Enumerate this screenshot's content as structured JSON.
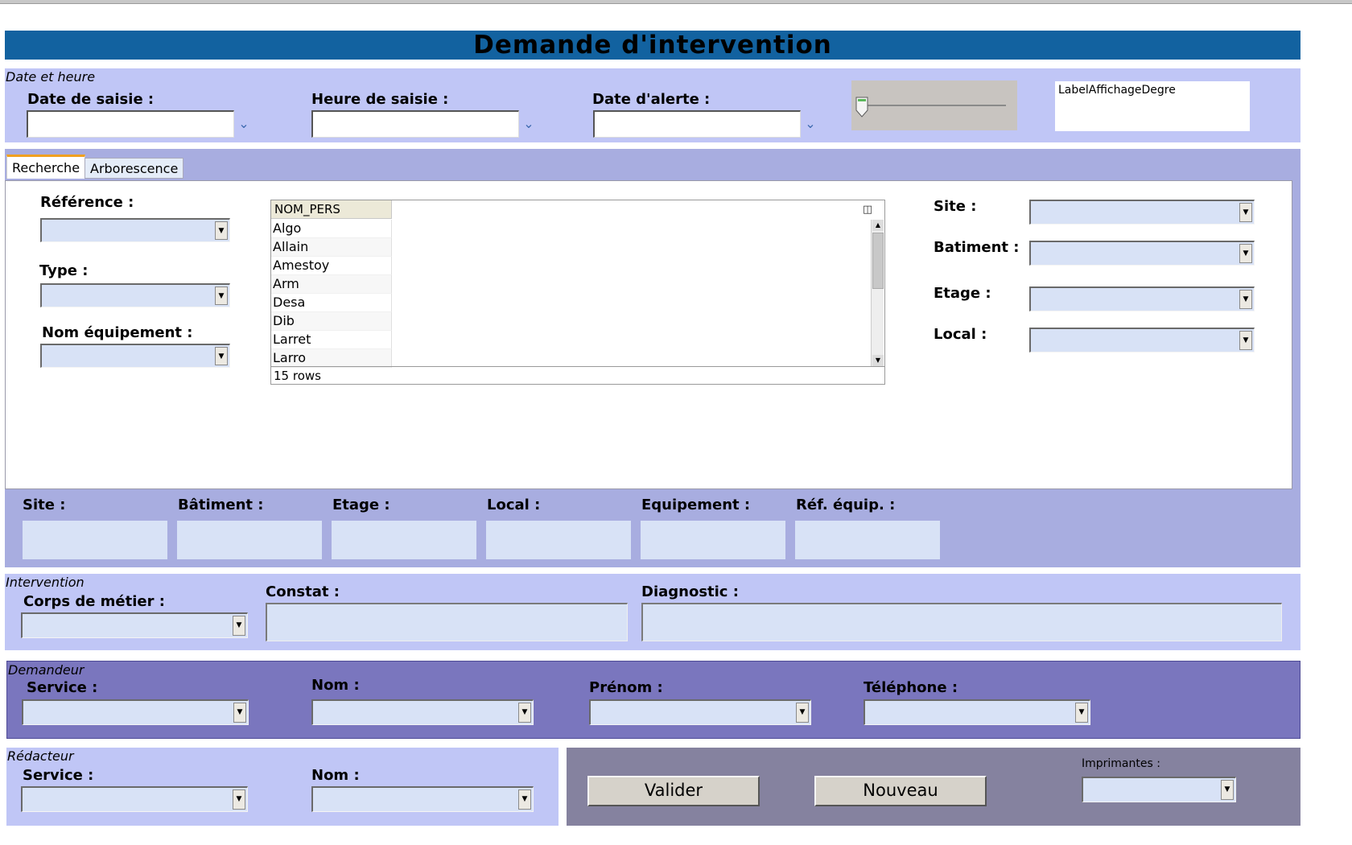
{
  "form": {
    "title": "Demande d'intervention"
  },
  "date_section": {
    "title": "Date et heure",
    "date_saisie_label": "Date de saisie :",
    "heure_saisie_label": "Heure de saisie :",
    "date_alerte_label": "Date d'alerte :",
    "degree_label": "LabelAffichageDegre",
    "slider_level": 0
  },
  "tabs": [
    {
      "label": "Recherche",
      "active": true
    },
    {
      "label": "Arborescence",
      "active": false
    }
  ],
  "search": {
    "reference_label": "Référence :",
    "type_label": "Type :",
    "nom_equipement_label": "Nom équipement :",
    "site_label": "Site :",
    "batiment_label": "Batiment :",
    "etage_label": "Etage :",
    "local_label": "Local :"
  },
  "grid": {
    "column": "NOM_PERS",
    "rows": [
      "Algo",
      "Allain",
      "Amestoy",
      "Arm",
      "Desa",
      "Dib",
      "Larret",
      "Larro"
    ],
    "row_count": "15 rows"
  },
  "location": {
    "site_label": "Site :",
    "batiment_label": "Bâtiment :",
    "etage_label": "Etage :",
    "local_label": "Local :",
    "equipement_label": "Equipement :",
    "ref_equip_label": "Réf. équip. :"
  },
  "intervention": {
    "title": "Intervention",
    "corps_metier_label": "Corps de métier :",
    "constat_label": "Constat :",
    "diagnostic_label": "Diagnostic :"
  },
  "demandeur": {
    "title": "Demandeur",
    "service_label": "Service :",
    "nom_label": "Nom :",
    "prenom_label": "Prénom :",
    "telephone_label": "Téléphone :"
  },
  "redacteur": {
    "title": "Rédacteur",
    "service_label": "Service :",
    "nom_label": "Nom :"
  },
  "actions": {
    "valider_label": "Valider",
    "nouveau_label": "Nouveau",
    "imprimantes_label": "Imprimantes :"
  },
  "colors": {
    "title_bar": "#1262a0",
    "panel_light": "#c0c6f6",
    "panel_mid": "#a8ade0",
    "panel_dark": "#7a76be",
    "panel_grey": "#85829f",
    "field": "#d8e2f6"
  }
}
